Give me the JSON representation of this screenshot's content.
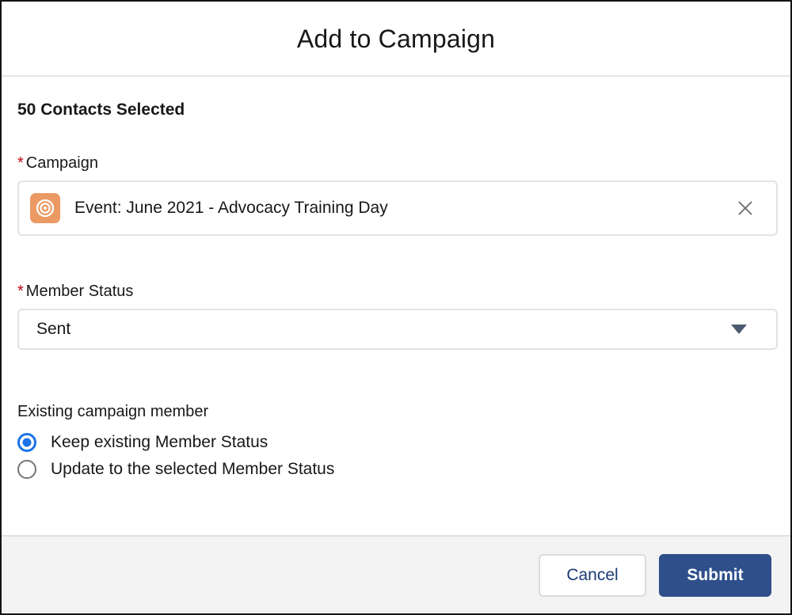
{
  "dialog": {
    "title": "Add to Campaign"
  },
  "body": {
    "selection_count": "50 Contacts Selected",
    "campaign": {
      "label": "Campaign",
      "required_marker": "*",
      "required": true,
      "selected_value": "Event: June 2021 - Advocacy Training Day",
      "entity_icon": "campaign-target-icon",
      "entity_icon_color": "#eb9a63",
      "clear_icon": "close-icon"
    },
    "member_status": {
      "label": "Member Status",
      "required_marker": "*",
      "required": true,
      "selected_value": "Sent",
      "dropdown_icon": "chevron-down-icon",
      "dropdown_icon_color": "#4a5a70"
    },
    "existing_member": {
      "legend": "Existing campaign member",
      "options": [
        {
          "label": "Keep existing Member Status",
          "checked": true
        },
        {
          "label": "Update to the selected Member Status",
          "checked": false
        }
      ],
      "selected_color": "#1a73e8"
    }
  },
  "footer": {
    "cancel_label": "Cancel",
    "submit_label": "Submit",
    "cancel_text_color": "#1b3a73",
    "submit_bg_color": "#2e4f8a"
  }
}
